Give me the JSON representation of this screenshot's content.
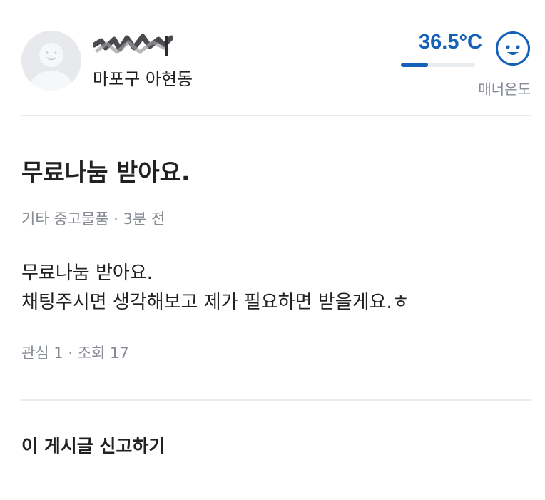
{
  "profile": {
    "region": "마포구 아현동",
    "manner_temperature": "36.5°C",
    "manner_label": "매너온도",
    "temperature_level_percent": 36.5,
    "face_icon": "smile-face-icon"
  },
  "article": {
    "title": "무료나눔 받아요.",
    "category": "기타 중고물품",
    "separator": " · ",
    "time_ago": "3분 전",
    "body_lines": [
      "무료나눔 받아요.",
      "채팅주시면 생각해보고 제가 필요하면 받을게요.ㅎ"
    ],
    "interest_label": "관심 1",
    "views_label": "조회 17"
  },
  "actions": {
    "report_label": "이 게시글 신고하기"
  },
  "colors": {
    "accent": "#1561b8",
    "muted": "#868b94",
    "divider": "#eaebee"
  }
}
